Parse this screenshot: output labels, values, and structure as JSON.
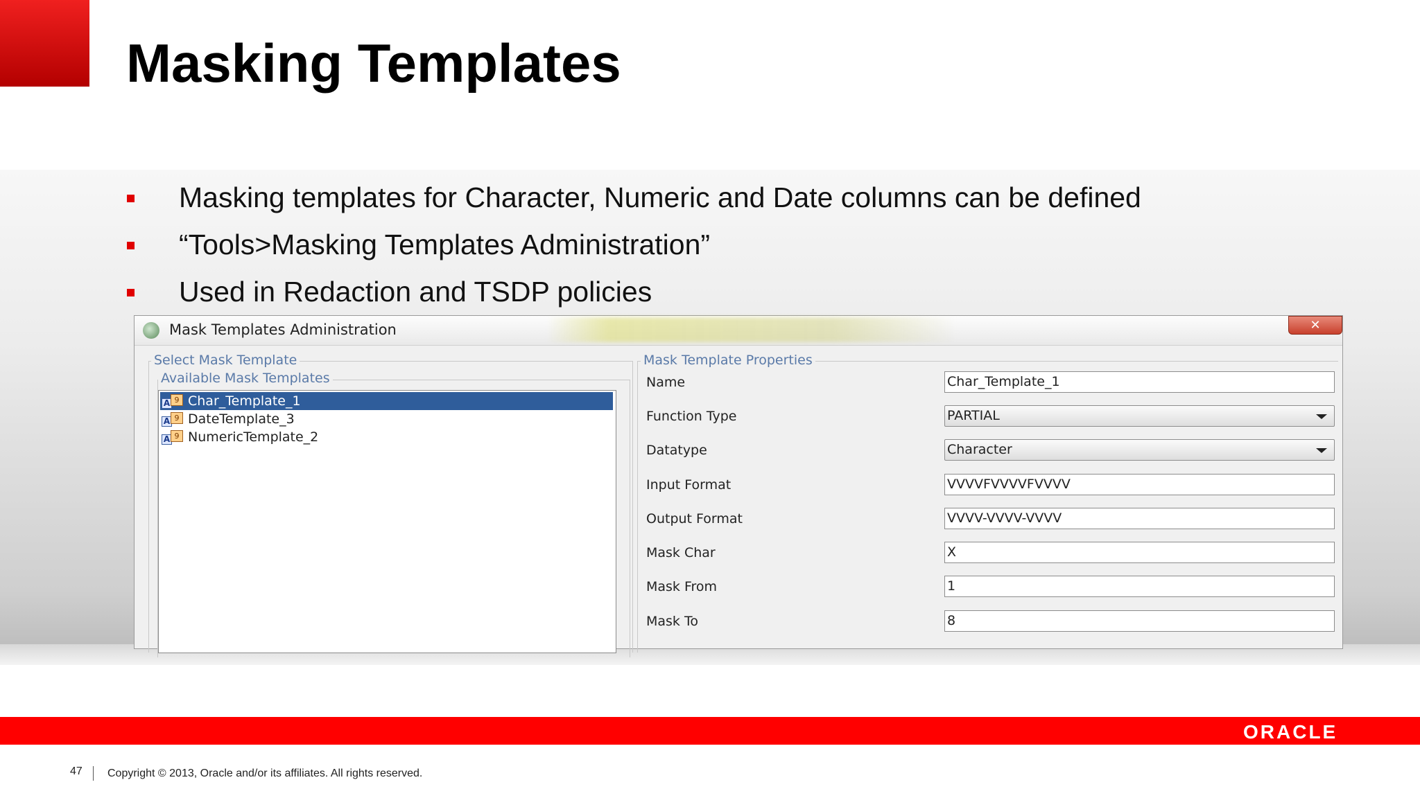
{
  "slide": {
    "title": "Masking Templates",
    "bullets": [
      "Masking templates for Character, Numeric and Date columns can be defined",
      "“Tools>Masking Templates Administration”",
      "Used in Redaction and TSDP policies"
    ],
    "page_number": "47",
    "copyright": "Copyright © 2013, Oracle and/or its affiliates. All rights reserved.",
    "logo": "ORACLE",
    "colors": {
      "accent_red": "#ff0000",
      "selection_blue": "#2f5d9b",
      "group_label": "#5a7aa8"
    }
  },
  "dialog": {
    "title": "Mask Templates Administration",
    "close_label": "✕",
    "select_group_label": "Select Mask Template",
    "available_group_label": "Available Mask Templates",
    "templates": [
      {
        "name": "Char_Template_1",
        "selected": true
      },
      {
        "name": "DateTemplate_3",
        "selected": false
      },
      {
        "name": "NumericTemplate_2",
        "selected": false
      }
    ],
    "properties_group_label": "Mask Template Properties",
    "properties": {
      "name": {
        "label": "Name",
        "value": "Char_Template_1"
      },
      "function_type": {
        "label": "Function Type",
        "value": "PARTIAL"
      },
      "datatype": {
        "label": "Datatype",
        "value": "Character"
      },
      "input_format": {
        "label": "Input Format",
        "value": "VVVVFVVVVFVVVV"
      },
      "output_format": {
        "label": "Output Format",
        "value": "VVVV-VVVV-VVVV"
      },
      "mask_char": {
        "label": "Mask Char",
        "value": "X"
      },
      "mask_from": {
        "label": "Mask From",
        "value": "1"
      },
      "mask_to": {
        "label": "Mask To",
        "value": "8"
      }
    }
  }
}
